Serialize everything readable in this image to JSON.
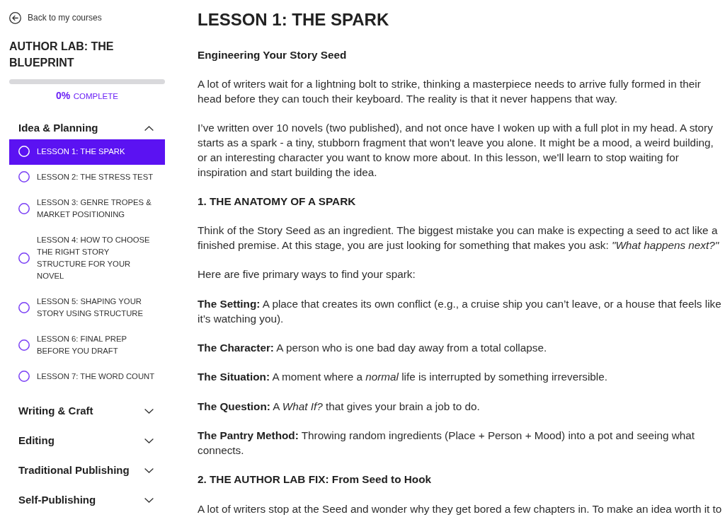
{
  "sidebar": {
    "back_link": "Back to my courses",
    "course_title": "AUTHOR LAB: THE BLUEPRINT",
    "progress": {
      "level": 0,
      "percent": "0%",
      "label": "COMPLETE"
    },
    "sections": [
      {
        "title": "Idea & Planning",
        "expanded": true,
        "lessons": [
          {
            "title": "LESSON 1: THE SPARK",
            "selected": true,
            "completed": false
          },
          {
            "title": "LESSON 2: THE STRESS TEST",
            "selected": false,
            "completed": false
          },
          {
            "title": "LESSON 3: GENRE TROPES & MARKET POSITIONING",
            "selected": false,
            "completed": false
          },
          {
            "title": "LESSON 4: HOW TO CHOOSE THE RIGHT STORY STRUCTURE FOR YOUR NOVEL",
            "selected": false,
            "completed": false
          },
          {
            "title": "LESSON 5: SHAPING YOUR STORY USING STRUCTURE",
            "selected": false,
            "completed": false
          },
          {
            "title": "LESSON 6: FINAL PREP BEFORE YOU DRAFT",
            "selected": false,
            "completed": false
          },
          {
            "title": "LESSON 7: THE WORD COUNT",
            "selected": false,
            "completed": false
          }
        ]
      },
      {
        "title": "Writing & Craft",
        "expanded": false
      },
      {
        "title": "Editing",
        "expanded": false
      },
      {
        "title": "Traditional Publishing",
        "expanded": false
      },
      {
        "title": "Self-Publishing",
        "expanded": false
      }
    ]
  },
  "lesson": {
    "title": "LESSON 1: THE SPARK",
    "blocks": [
      {
        "kind": "subheading",
        "text": "Engineering Your Story Seed"
      },
      {
        "kind": "paragraph",
        "text": "A lot of writers wait for a lightning bolt to strike, thinking a masterpiece needs to arrive fully formed in their head before they can touch their keyboard. The reality is that it never happens that way."
      },
      {
        "kind": "paragraph",
        "text": "I’ve written over 10 novels (two published), and not once have I woken up with a full plot in my head. A story starts as a spark - a tiny, stubborn fragment that won't leave you alone. It might be a mood, a weird building, or an interesting character you want to know more about. In this lesson, we'll learn to stop waiting for inspiration and start building the idea."
      },
      {
        "kind": "heading",
        "text": "1. THE ANATOMY OF A SPARK"
      },
      {
        "kind": "paragraph",
        "text": "Think of the Story Seed as an ingredient. The biggest mistake you can make is expecting a seed to act like a finished premise. At this stage, you are just looking for something that makes you ask: *\"What happens next?\"*"
      },
      {
        "kind": "paragraph",
        "text": "Here are five primary ways to find your spark:"
      },
      {
        "kind": "paragraph",
        "text": "**The Setting:** A place that creates its own conflict (e.g., a cruise ship you can’t leave, or a house that feels like it’s watching you)."
      },
      {
        "kind": "paragraph",
        "text": "**The Character:** A person who is one bad day away from a total collapse."
      },
      {
        "kind": "paragraph",
        "text": "**The Situation:** A moment where a *normal* life is interrupted by something irreversible."
      },
      {
        "kind": "paragraph",
        "text": "**The Question:** A *What If?* that gives your brain a job to do."
      },
      {
        "kind": "paragraph",
        "text": "**The Pantry Method:** Throwing random ingredients (Place + Person + Mood) into a pot and seeing what connects."
      },
      {
        "kind": "heading",
        "text": "2. THE AUTHOR LAB FIX: From Seed to Hook"
      },
      {
        "kind": "paragraph",
        "text": "A lot of writers stop at the Seed and wonder why they get bored a few chapters in. To make an idea worth it to"
      }
    ]
  }
}
